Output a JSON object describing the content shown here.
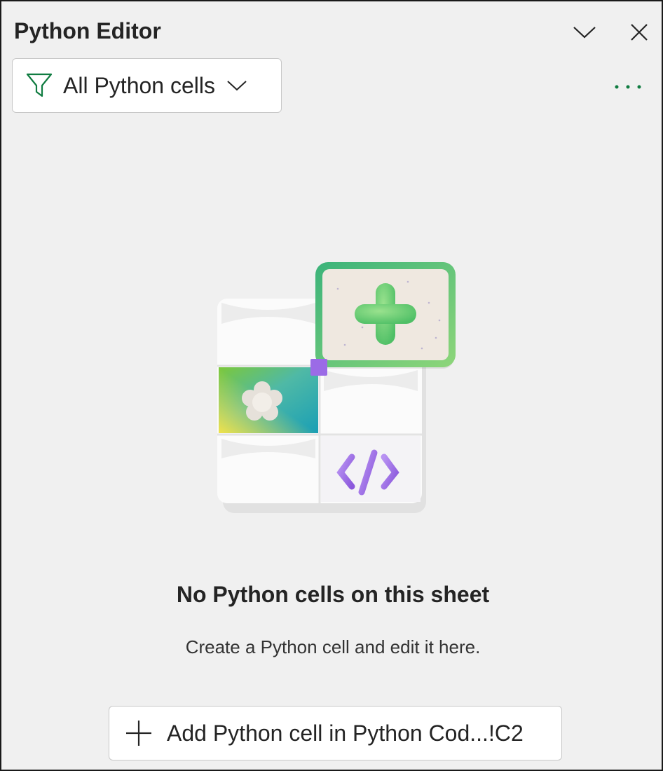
{
  "header": {
    "title": "Python Editor",
    "collapse_icon": "chevron-down-icon",
    "close_icon": "close-icon"
  },
  "filter": {
    "label": "All Python cells",
    "icon": "filter-icon",
    "dropdown_icon": "chevron-down-icon",
    "icon_color": "#107C41"
  },
  "more_options": {
    "icon": "more-horizontal-icon",
    "color": "#107C41"
  },
  "empty_state": {
    "title": "No Python cells on this sheet",
    "description": "Create a Python cell and edit it here."
  },
  "add_button": {
    "label": "Add Python cell in Python Cod...!C2",
    "icon": "plus-icon"
  }
}
